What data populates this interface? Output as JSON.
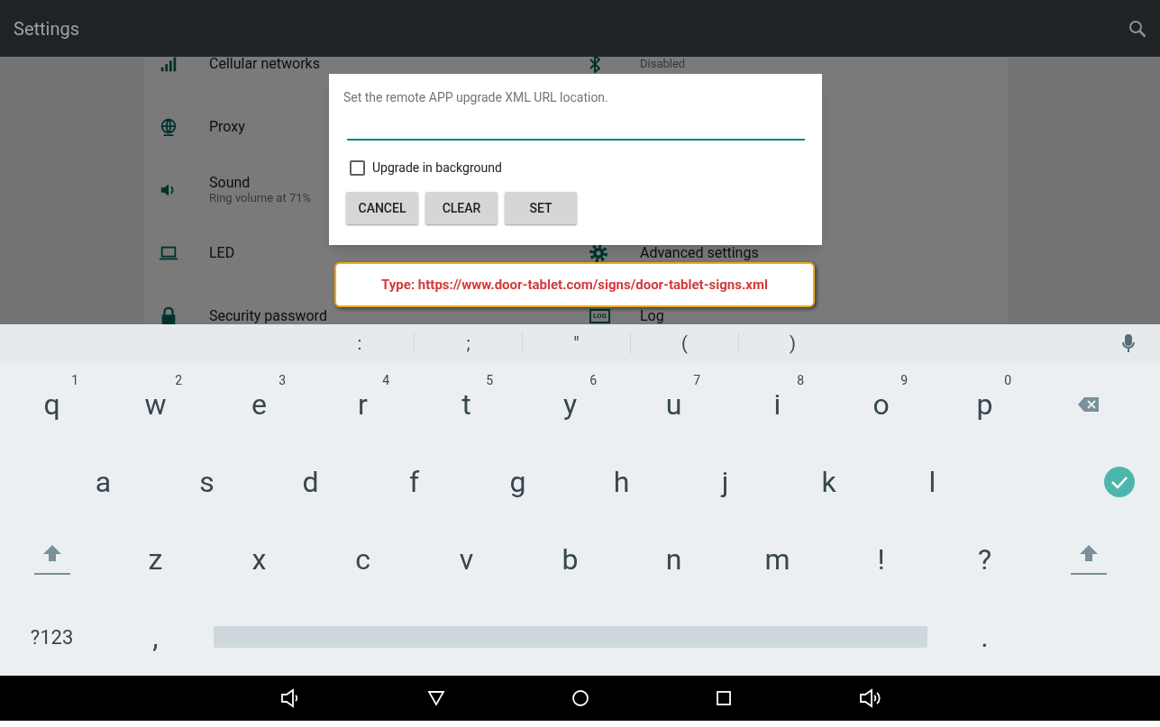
{
  "app_bar": {
    "title": "Settings"
  },
  "settings_left": [
    {
      "kind": "signal",
      "title": "Cellular networks"
    },
    {
      "kind": "globe",
      "title": "Proxy"
    },
    {
      "kind": "sound",
      "title": "Sound",
      "subtitle": "Ring volume at 71%"
    },
    {
      "kind": "laptop",
      "title": "LED"
    },
    {
      "kind": "lock",
      "title": "Security password"
    }
  ],
  "settings_right": [
    {
      "kind": "bluetooth",
      "subtitle": "Disabled"
    },
    {
      "kind": "none"
    },
    {
      "kind": "none"
    },
    {
      "kind": "gear",
      "title": "Advanced settings"
    },
    {
      "kind": "log",
      "title": "Log",
      "icon_text": "LOG"
    }
  ],
  "dialog": {
    "message": "Set the remote APP upgrade XML URL location.",
    "checkbox": {
      "label": "Upgrade in background",
      "checked": false
    },
    "buttons": [
      "CANCEL",
      "CLEAR",
      "SET"
    ]
  },
  "callout": {
    "text": "Type: https://www.door-tablet.com/signs/door-tablet-signs.xml"
  },
  "suggestions": [
    ":",
    ";",
    "\"",
    "(",
    ")"
  ],
  "keyboard_rows": [
    [
      {
        "kind": "letter",
        "label": "q",
        "hint": "1"
      },
      {
        "kind": "letter",
        "label": "w",
        "hint": "2"
      },
      {
        "kind": "letter",
        "label": "e",
        "hint": "3"
      },
      {
        "kind": "letter",
        "label": "r",
        "hint": "4"
      },
      {
        "kind": "letter",
        "label": "t",
        "hint": "5"
      },
      {
        "kind": "letter",
        "label": "y",
        "hint": "6"
      },
      {
        "kind": "letter",
        "label": "u",
        "hint": "7"
      },
      {
        "kind": "letter",
        "label": "i",
        "hint": "8"
      },
      {
        "kind": "letter",
        "label": "o",
        "hint": "9"
      },
      {
        "kind": "letter",
        "label": "p",
        "hint": "0"
      },
      {
        "kind": "backspace"
      }
    ],
    [
      {
        "kind": "gap"
      },
      {
        "kind": "letter",
        "label": "a"
      },
      {
        "kind": "letter",
        "label": "s"
      },
      {
        "kind": "letter",
        "label": "d"
      },
      {
        "kind": "letter",
        "label": "f"
      },
      {
        "kind": "letter",
        "label": "g"
      },
      {
        "kind": "letter",
        "label": "h"
      },
      {
        "kind": "letter",
        "label": "j"
      },
      {
        "kind": "letter",
        "label": "k"
      },
      {
        "kind": "letter",
        "label": "l"
      },
      {
        "kind": "enter"
      }
    ],
    [
      {
        "kind": "shift"
      },
      {
        "kind": "letter",
        "label": "z"
      },
      {
        "kind": "letter",
        "label": "x"
      },
      {
        "kind": "letter",
        "label": "c"
      },
      {
        "kind": "letter",
        "label": "v"
      },
      {
        "kind": "letter",
        "label": "b"
      },
      {
        "kind": "letter",
        "label": "n"
      },
      {
        "kind": "letter",
        "label": "m"
      },
      {
        "kind": "letter",
        "label": "!"
      },
      {
        "kind": "letter",
        "label": "?"
      },
      {
        "kind": "shift"
      }
    ],
    [
      {
        "kind": "symbols",
        "label": "?123"
      },
      {
        "kind": "letter",
        "label": ","
      },
      {
        "kind": "space"
      },
      {
        "kind": "letter",
        "label": "."
      },
      {
        "kind": "gap"
      }
    ]
  ],
  "nav_bar": [
    {
      "kind": "volume-down"
    },
    {
      "kind": "back"
    },
    {
      "kind": "home"
    },
    {
      "kind": "recents"
    },
    {
      "kind": "volume-up"
    }
  ]
}
